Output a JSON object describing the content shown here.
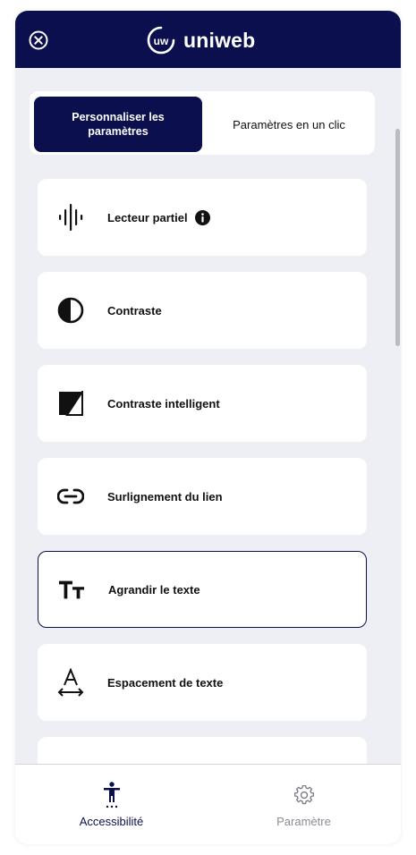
{
  "header": {
    "logo_text": "uniweb",
    "logo_mark": "uw"
  },
  "tabs": [
    {
      "label": "Personnaliser les paramètres",
      "active": true
    },
    {
      "label": "Paramètres en un clic",
      "active": false
    }
  ],
  "features": [
    {
      "label": "Lecteur partiel",
      "icon": "audio-wave-icon",
      "info": true
    },
    {
      "label": "Contraste",
      "icon": "contrast-icon"
    },
    {
      "label": "Contraste intelligent",
      "icon": "smart-contrast-icon"
    },
    {
      "label": "Surlignement du lien",
      "icon": "link-icon"
    },
    {
      "label": "Agrandir le texte",
      "icon": "text-size-icon",
      "selected": true
    },
    {
      "label": "Espacement de texte",
      "icon": "text-spacing-icon"
    }
  ],
  "bottom_nav": [
    {
      "label": "Accessibilité",
      "icon": "accessibility-icon",
      "active": true
    },
    {
      "label": "Paramètre",
      "icon": "gear-icon",
      "active": false
    }
  ],
  "colors": {
    "brand": "#0b0f4d",
    "background": "#eeeff5",
    "card": "#ffffff",
    "inactive_text": "#8b8b93"
  }
}
